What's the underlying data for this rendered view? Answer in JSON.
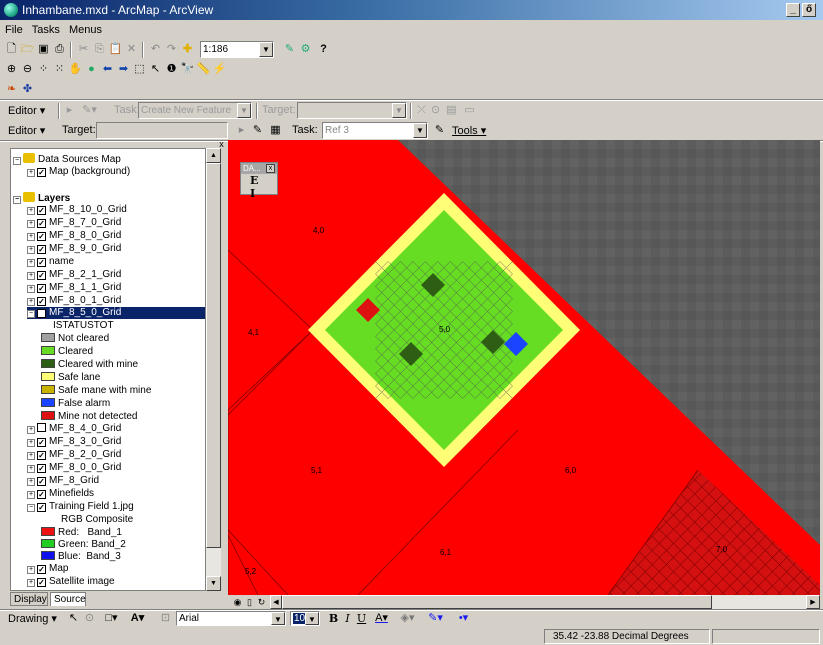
{
  "window": {
    "title": "Inhambane.mxd - ArcMap - ArcView",
    "buttons": [
      "_",
      "ő"
    ]
  },
  "menus": [
    "File",
    "Tasks",
    "Menus"
  ],
  "standard_toolbar": {
    "scale": "1:186"
  },
  "editor_toolbar_1": {
    "editor": "Editor ▾",
    "task_label": "Task:",
    "task_value": "Create New Feature",
    "target_label": "Target:",
    "target_value": ""
  },
  "editor_toolbar_2": {
    "editor": "Editor ▾",
    "target_label": "Target:",
    "target_value": "",
    "task_label": "Task:",
    "task_value": "Ref 3",
    "tools": "Tools ▾"
  },
  "toc": {
    "data_frames": [
      {
        "label": "Data Sources Map",
        "children": [
          "Map (background)"
        ]
      },
      {
        "label": "Layers"
      }
    ],
    "layers_before": [
      "MF_8_10_0_Grid",
      "MF_8_7_0_Grid",
      "MF_8_8_0_Grid",
      "MF_8_9_0_Grid",
      "name",
      "MF_8_2_1_Grid",
      "MF_8_1_1_Grid",
      "MF_8_0_1_Grid"
    ],
    "selected_layer": "MF_8_5_0_Grid",
    "field": "ISTATUSTOT",
    "legend": [
      {
        "label": "Not cleared",
        "color": "#a0a0a0"
      },
      {
        "label": "Cleared",
        "color": "#66dd22"
      },
      {
        "label": "Cleared with mine",
        "color": "#2e5e14"
      },
      {
        "label": "Safe lane",
        "color": "#ffff77"
      },
      {
        "label": "Safe mane with mine",
        "color": "#c8b400"
      },
      {
        "label": "False alarm",
        "color": "#1a44ff"
      },
      {
        "label": "Mine not detected",
        "color": "#dd1111"
      }
    ],
    "layers_after": [
      {
        "label": "MF_8_4_0_Grid",
        "checked": false
      },
      {
        "label": "MF_8_3_0_Grid",
        "checked": true
      },
      {
        "label": "MF_8_2_0_Grid",
        "checked": true
      },
      {
        "label": "MF_8_0_0_Grid",
        "checked": true
      },
      {
        "label": "MF_8_Grid",
        "checked": true
      },
      {
        "label": "Minefields",
        "checked": true
      }
    ],
    "raster_layer": "Training Field 1.jpg",
    "raster_legend_title": "RGB Composite",
    "bands": [
      {
        "label": "Red:   Band_1",
        "color": "#ee1111"
      },
      {
        "label": "Green: Band_2",
        "color": "#22cc22"
      },
      {
        "label": "Blue:  Band_3",
        "color": "#1111ee"
      }
    ],
    "bottom_layers": [
      "Map",
      "Satellite image"
    ]
  },
  "tabs": [
    "Display",
    "Source"
  ],
  "map": {
    "labels": [
      "4,0",
      "4,1",
      "5,0",
      "5,1",
      "6,0",
      "6,1",
      "7,0",
      "5,2"
    ],
    "floating_toolbar": {
      "title": "DΑ...",
      "buttons": "E I"
    }
  },
  "drawing_toolbar": {
    "drawing": "Drawing ▾",
    "font": "Arial",
    "size": "10"
  },
  "status": {
    "coords": "35.42  -23.88 Decimal Degrees"
  },
  "colors": {
    "red_field": "#ff0000",
    "cleared": "#66dd22",
    "safe_lane": "#ffff77",
    "satellite": "#5a5a5a"
  }
}
